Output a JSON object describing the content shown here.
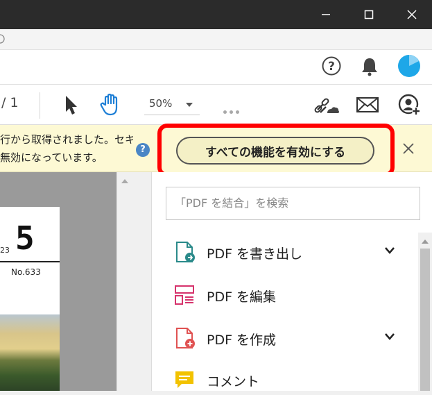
{
  "toolbar": {
    "page_indicator": "/ 1",
    "zoom_value": "50%"
  },
  "notification": {
    "message_line1": "行から取得されました。セキ",
    "message_line2": "無効になっています。",
    "help_glyph": "?",
    "enable_button_label": "すべての機能を有効にする"
  },
  "document": {
    "page_big_char": "5",
    "page_small_num": "23",
    "page_issue": "No.633"
  },
  "right_panel": {
    "search_placeholder": "「PDF を結合」を検索",
    "tools": [
      {
        "label": "PDF を書き出し",
        "icon": "export-pdf-icon",
        "color": "#2a8a8a",
        "expandable": true
      },
      {
        "label": "PDF を編集",
        "icon": "edit-pdf-icon",
        "color": "#d6336c",
        "expandable": false
      },
      {
        "label": "PDF を作成",
        "icon": "create-pdf-icon",
        "color": "#e05252",
        "expandable": true
      },
      {
        "label": "コメント",
        "icon": "comment-icon",
        "color": "#f2c200",
        "expandable": false
      }
    ]
  },
  "colors": {
    "highlight": "#ff0000",
    "notification_bg": "#fdf9d4",
    "avatar": "#1ea7e8"
  }
}
